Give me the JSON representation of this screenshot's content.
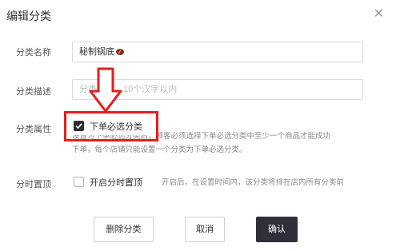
{
  "dialog": {
    "title": "编辑分类",
    "close_icon": "close-icon"
  },
  "name": {
    "label": "分类名称",
    "value": "秘制锅底"
  },
  "desc": {
    "label": "分类描述",
    "placeholder": "分类描述，10个汉字以内"
  },
  "attr": {
    "label": "分类属性",
    "checkbox_label": "下单必选分类",
    "checked": true,
    "hint_line1": "设置为下单必选分类后，顾客必须选择下单必选分类中至少一个商品才能成功",
    "hint_line2": "下单，每个店铺只能设置一个分类为下单必选分类。"
  },
  "pin": {
    "label": "分时置顶",
    "checkbox_label": "开启分时置顶",
    "checked": false,
    "hint": "开启后，在设置时间内，该分类将排在店内所有分类前"
  },
  "buttons": {
    "delete": "删除分类",
    "cancel": "取消",
    "confirm": "确认"
  },
  "colors": {
    "annotation_red": "#e41f1f",
    "primary": "#2f2e3a"
  }
}
